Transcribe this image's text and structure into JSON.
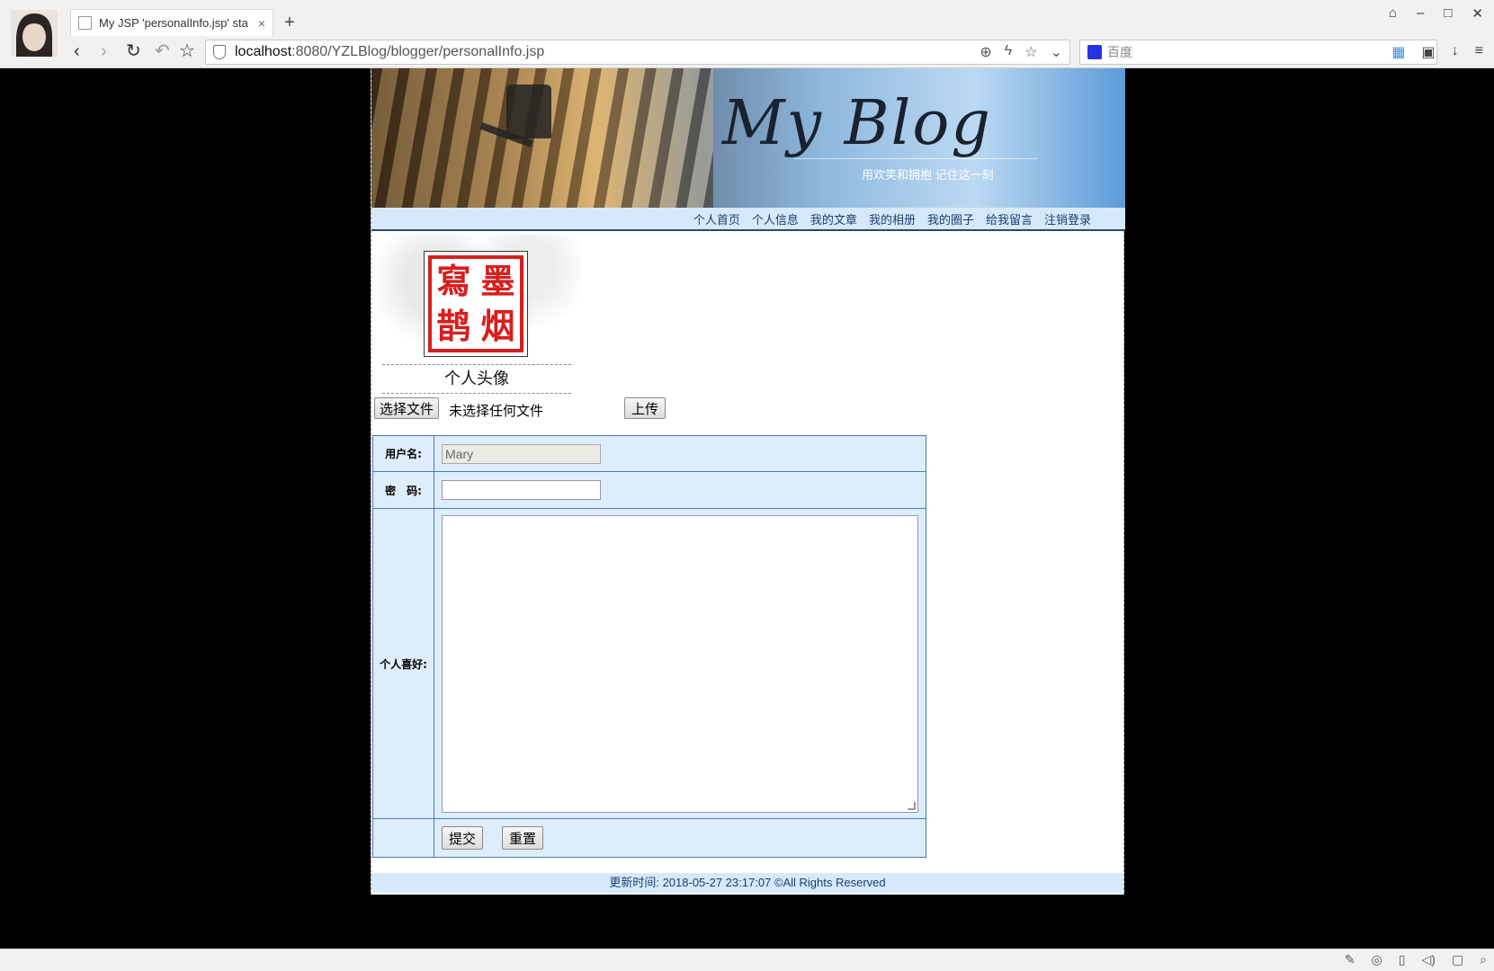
{
  "browser": {
    "tab_title": "My JSP 'personalInfo.jsp' sta",
    "tab_close": "×",
    "new_tab": "+",
    "url_host": "localhost",
    "url_path": ":8080/YZLBlog/blogger/personalInfo.jsp",
    "search_placeholder": "百度",
    "icons": {
      "back": "back-icon",
      "forward": "forward-icon",
      "reload": "reload-icon",
      "undo": "undo-icon",
      "bookmark": "star-icon"
    }
  },
  "banner": {
    "logo": "My Blog",
    "slogan": "用欢笑和拥抱 记住这一刻"
  },
  "menu": {
    "items": [
      "个人首页",
      "个人信息",
      "我的文章",
      "我的相册",
      "我的圈子",
      "给我留言",
      "注销登录"
    ]
  },
  "avatar": {
    "seal_chars": [
      "墨",
      "寫",
      "烟",
      "鹊"
    ],
    "caption": "个人头像"
  },
  "upload": {
    "choose_label": "选择文件",
    "status": "未选择任何文件",
    "upload_label": "上传"
  },
  "form": {
    "username_label": "用户名:",
    "username_value": "Mary",
    "password_label": "密　码:",
    "password_value": "",
    "hobby_label": "个人喜好:",
    "hobby_value": "",
    "submit_label": "提交",
    "reset_label": "重置"
  },
  "footer": {
    "text": "更新时间: 2018-05-27 23:17:07 ©All Rights Reserved"
  }
}
